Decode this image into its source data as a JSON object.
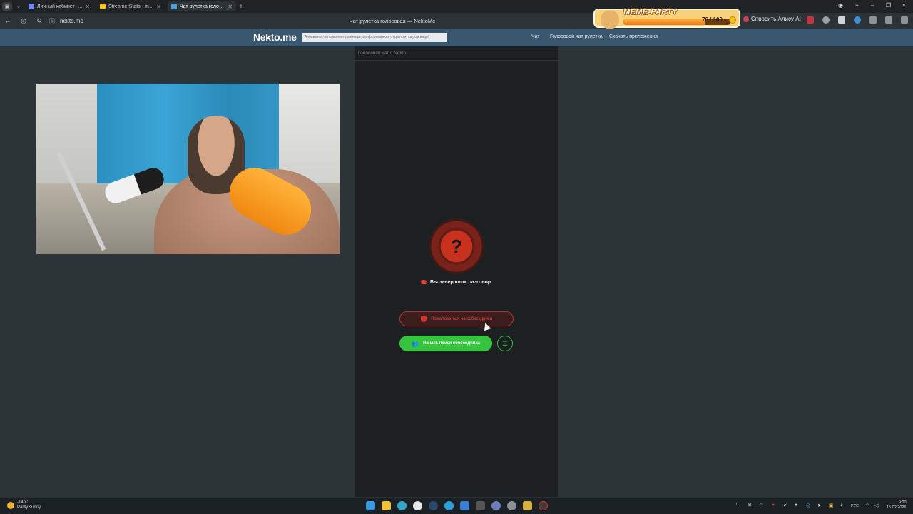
{
  "browser": {
    "tabs": [
      {
        "title": "Личный кабинет - Rampage",
        "favicon_color": "#6c8cff",
        "active": false
      },
      {
        "title": "StreamerStats - masadach",
        "favicon_color": "#f5c518",
        "active": false
      },
      {
        "title": "Чат рулетка голосовая",
        "favicon_color": "#4ea0d8",
        "active": true
      }
    ],
    "url": "nekto.me",
    "page_title": "Чат рулетка голосовая — NektoMe",
    "ask_alice": "Спросить Алису AI"
  },
  "meme_party": {
    "title": "MEME-PARTY",
    "count": "76 / 100",
    "progress": 0.76
  },
  "site": {
    "logo": "Nekto.me",
    "notice": "Анонимность позволяет размещать информацию в открытом, сыром виде!",
    "menu": [
      "Чат",
      "Голосовой чат рулетка",
      "Скачать приложения"
    ]
  },
  "chat": {
    "panel_title": "Голосовой чат с Nekto",
    "question": "?",
    "ended_text": "Вы завершили разговор",
    "report_button": "Пожаловаться на собеседника",
    "search_button": "Начать поиск собеседника"
  },
  "taskbar": {
    "temperature": "-14°C",
    "weather": "Partly sunny",
    "lang": "РУС",
    "time": "9:00",
    "date": "15.02.2026"
  }
}
